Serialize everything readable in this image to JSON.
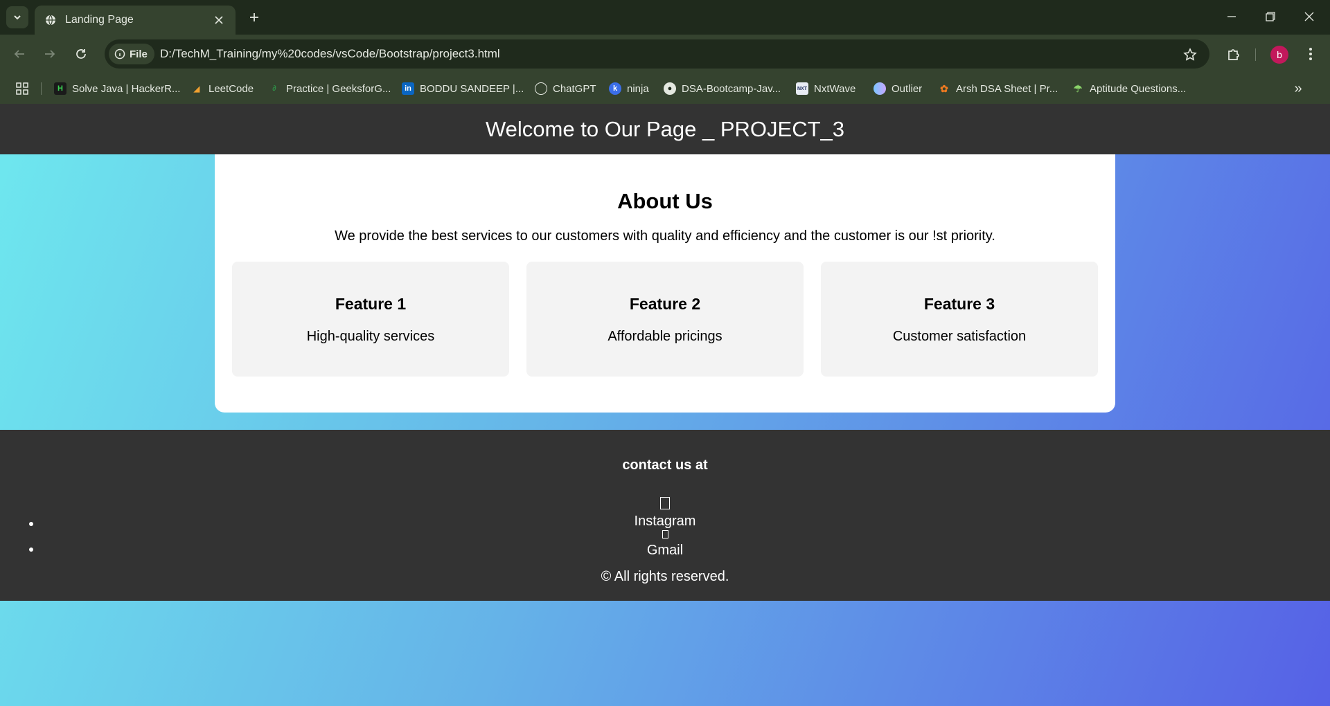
{
  "browser": {
    "tab_title": "Landing Page",
    "omnibox_chip": "File",
    "url": "D:/TechM_Training/my%20codes/vsCode/Bootstrap/project3.html",
    "profile_initial": "b",
    "bookmarks": [
      {
        "label": "Solve Java | HackerR...",
        "icon": "hackerrank-icon"
      },
      {
        "label": "LeetCode",
        "icon": "leetcode-icon"
      },
      {
        "label": "Practice | GeeksforG...",
        "icon": "geeksforgeeks-icon"
      },
      {
        "label": "BODDU SANDEEP |...",
        "icon": "linkedin-icon"
      },
      {
        "label": "ChatGPT",
        "icon": "chatgpt-icon"
      },
      {
        "label": "ninja",
        "icon": "ninja-icon"
      },
      {
        "label": "DSA-Bootcamp-Jav...",
        "icon": "github-icon"
      },
      {
        "label": "NxtWave",
        "icon": "nxtwave-icon"
      },
      {
        "label": "Outlier",
        "icon": "outlier-icon"
      },
      {
        "label": "Arsh DSA Sheet | Pr...",
        "icon": "arsh-icon"
      },
      {
        "label": "Aptitude Questions...",
        "icon": "aptitude-icon"
      }
    ]
  },
  "page": {
    "header_title": "Welcome to Our Page _ PROJECT_3",
    "about": {
      "title": "About Us",
      "text": "We provide the best services to our customers with quality and efficiency and the customer is our !st priority."
    },
    "features": [
      {
        "title": "Feature 1",
        "text": "High-quality services"
      },
      {
        "title": "Feature 2",
        "text": "Affordable pricings"
      },
      {
        "title": "Feature 3",
        "text": "Customer satisfaction"
      }
    ],
    "footer": {
      "contact": "contact us at",
      "socials": [
        {
          "name": "Instagram",
          "icon": "missing-glyph-icon"
        },
        {
          "name": "Gmail",
          "icon": "missing-glyph-icon"
        }
      ],
      "copyright": "© All rights reserved."
    }
  },
  "colors": {
    "chrome_dark": "#1f2a1c",
    "chrome_mid": "#35432f",
    "site_bar": "#333333",
    "gradient_start": "#6ee8ee",
    "gradient_end": "#5661e6",
    "avatar": "#c2185b"
  }
}
